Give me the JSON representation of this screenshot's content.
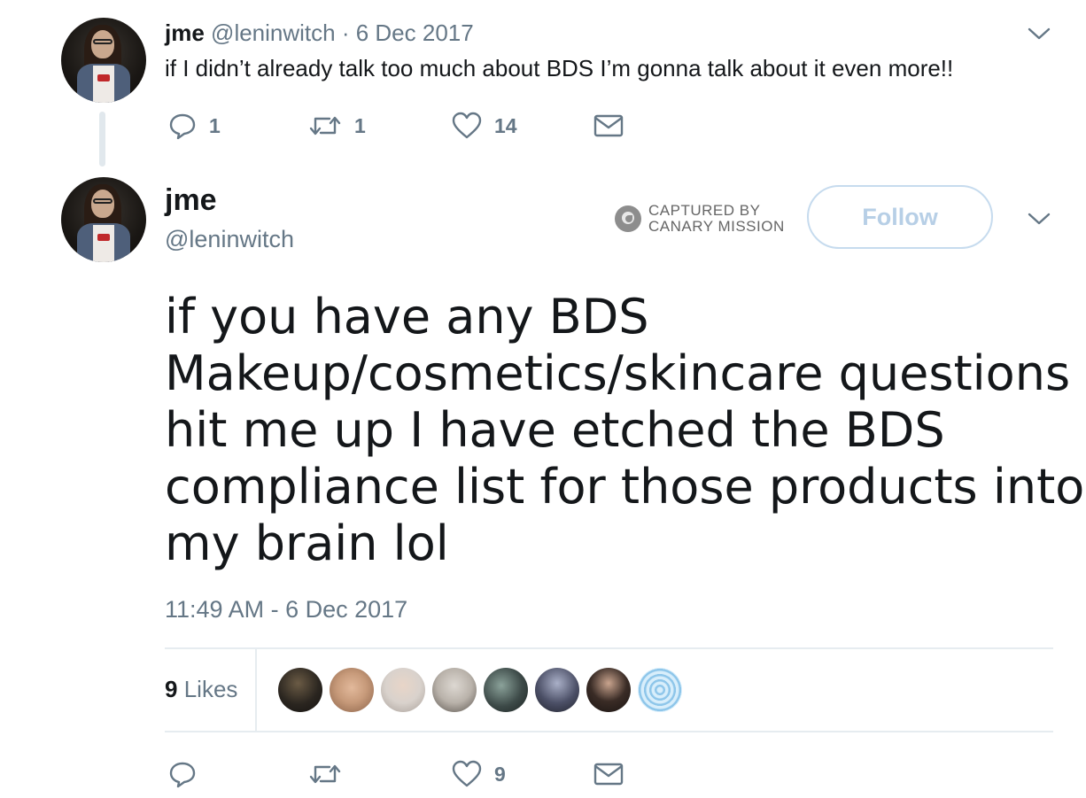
{
  "tweet1": {
    "name": "jme",
    "handle_date": "@leninwitch · 6 Dec 2017",
    "text": "if  I didn’t already talk too much about BDS I’m gonna talk about it even more!!",
    "replies": "1",
    "retweets": "1",
    "likes": "14"
  },
  "tweet2": {
    "name": "jme",
    "handle": "@leninwitch",
    "canary_line1": "CAPTURED BY",
    "canary_line2": "CANARY MISSION",
    "follow_label": "Follow",
    "text_lines": [
      "if you have any BDS",
      "Makeup/cosmetics/skincare questions",
      "hit me up I have etched the BDS",
      "compliance list for those products into",
      "my brain lol"
    ],
    "timestamp": "11:49 AM - 6 Dec 2017",
    "likes_count": "9",
    "likes_word": "Likes",
    "action_likes": "9"
  },
  "likers": [
    {
      "icon": "liker-avatar-1",
      "color": "#2b2620"
    },
    {
      "icon": "liker-avatar-2",
      "color": "#c79a7a"
    },
    {
      "icon": "liker-avatar-3",
      "color": "#d9d2cc"
    },
    {
      "icon": "liker-avatar-4",
      "color": "#b9b2aa"
    },
    {
      "icon": "liker-avatar-5",
      "color": "#3d4a48"
    },
    {
      "icon": "liker-avatar-6",
      "color": "#4b4f66"
    },
    {
      "icon": "liker-avatar-7",
      "color": "#3a2c26"
    },
    {
      "icon": "liker-avatar-8",
      "color": "#a8d3ef"
    }
  ],
  "colors": {
    "text": "#14171a",
    "secondary": "#657786",
    "follow_border": "#c6dbee",
    "divider": "#e6ecf0"
  }
}
